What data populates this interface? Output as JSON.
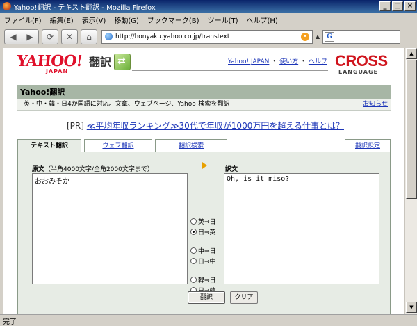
{
  "window": {
    "title": "Yahoo!翻訳 - テキスト翻訳 - Mozilla Firefox",
    "controls": [
      "_",
      "□",
      "×"
    ]
  },
  "menu": [
    "ファイル(F)",
    "編集(E)",
    "表示(V)",
    "移動(G)",
    "ブックマーク(B)",
    "ツール(T)",
    "ヘルプ(H)"
  ],
  "toolbar": {
    "url": "http://honyaku.yahoo.co.jp/transtext",
    "search_icon": "G"
  },
  "header": {
    "logo_yahoo": "YAHOO!",
    "logo_japan": "JAPAN",
    "logo_service": "翻訳",
    "links": [
      "Yahoo! JAPAN",
      "使い方",
      "ヘルプ"
    ],
    "partner_logo": "CROSS",
    "partner_sub": "LANGUAGE"
  },
  "service_bar": {
    "title": "Yahoo!翻訳",
    "description": "英・中・韓・日4か国語に対応。文章、ウェブページ、Yahoo!検索を翻訳",
    "notice_link": "お知らせ"
  },
  "pr": {
    "tag": "[PR]",
    "link": "≪平均年収ランキング≫30代で年収が1000万円を超える仕事とは？"
  },
  "tabs": [
    "テキスト翻訳",
    "ウェブ翻訳",
    "翻訳検索",
    "翻訳設定"
  ],
  "translate": {
    "source_label": "原文",
    "source_hint": "（半角4000文字/全角2000文字まで）",
    "source_text": "おおみそか",
    "target_label": "訳文",
    "target_text": "Oh, is it miso?",
    "directions": [
      {
        "label": "英⇒日",
        "checked": false
      },
      {
        "label": "日⇒英",
        "checked": true
      },
      {
        "label": "中⇒日",
        "checked": false
      },
      {
        "label": "日⇒中",
        "checked": false
      },
      {
        "label": "韓⇒日",
        "checked": false
      },
      {
        "label": "日⇒韓",
        "checked": false
      }
    ],
    "translate_button": "翻訳",
    "clear_button": "クリア"
  },
  "status": "完了"
}
